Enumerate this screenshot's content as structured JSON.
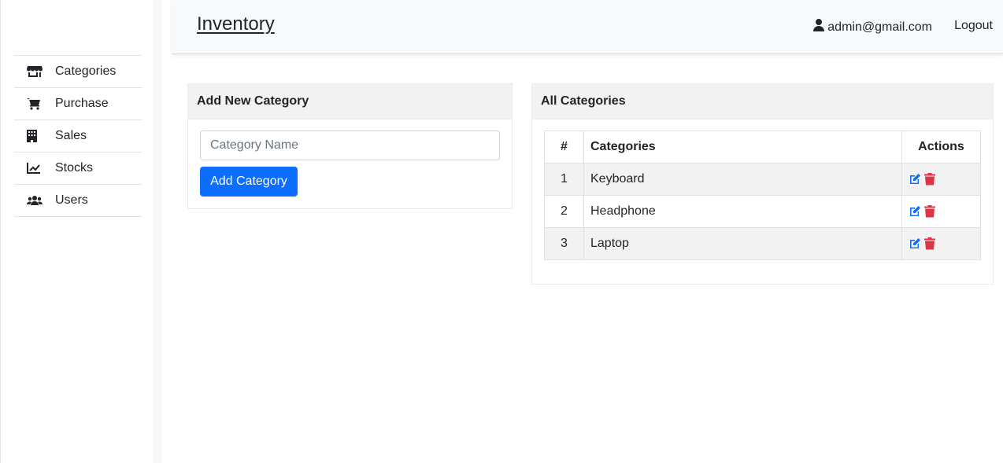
{
  "app": {
    "brand": "Inventory"
  },
  "header": {
    "user_email": "admin@gmail.com",
    "logout_label": "Logout"
  },
  "sidebar": {
    "items": [
      {
        "label": "Categories",
        "icon": "store-icon"
      },
      {
        "label": "Purchase",
        "icon": "cart-icon"
      },
      {
        "label": "Sales",
        "icon": "building-icon"
      },
      {
        "label": "Stocks",
        "icon": "chart-line-icon"
      },
      {
        "label": "Users",
        "icon": "users-icon"
      }
    ]
  },
  "add_form": {
    "title": "Add New Category",
    "input_placeholder": "Category Name",
    "input_value": "",
    "button_label": "Add Category"
  },
  "category_list": {
    "title": "All Categories",
    "columns": [
      "#",
      "Categories",
      "Actions"
    ],
    "rows": [
      {
        "num": "1",
        "name": "Keyboard"
      },
      {
        "num": "2",
        "name": "Headphone"
      },
      {
        "num": "3",
        "name": "Laptop"
      }
    ]
  },
  "colors": {
    "primary": "#0d6efd",
    "danger": "#dc3545",
    "edit": "#0d6efd"
  }
}
